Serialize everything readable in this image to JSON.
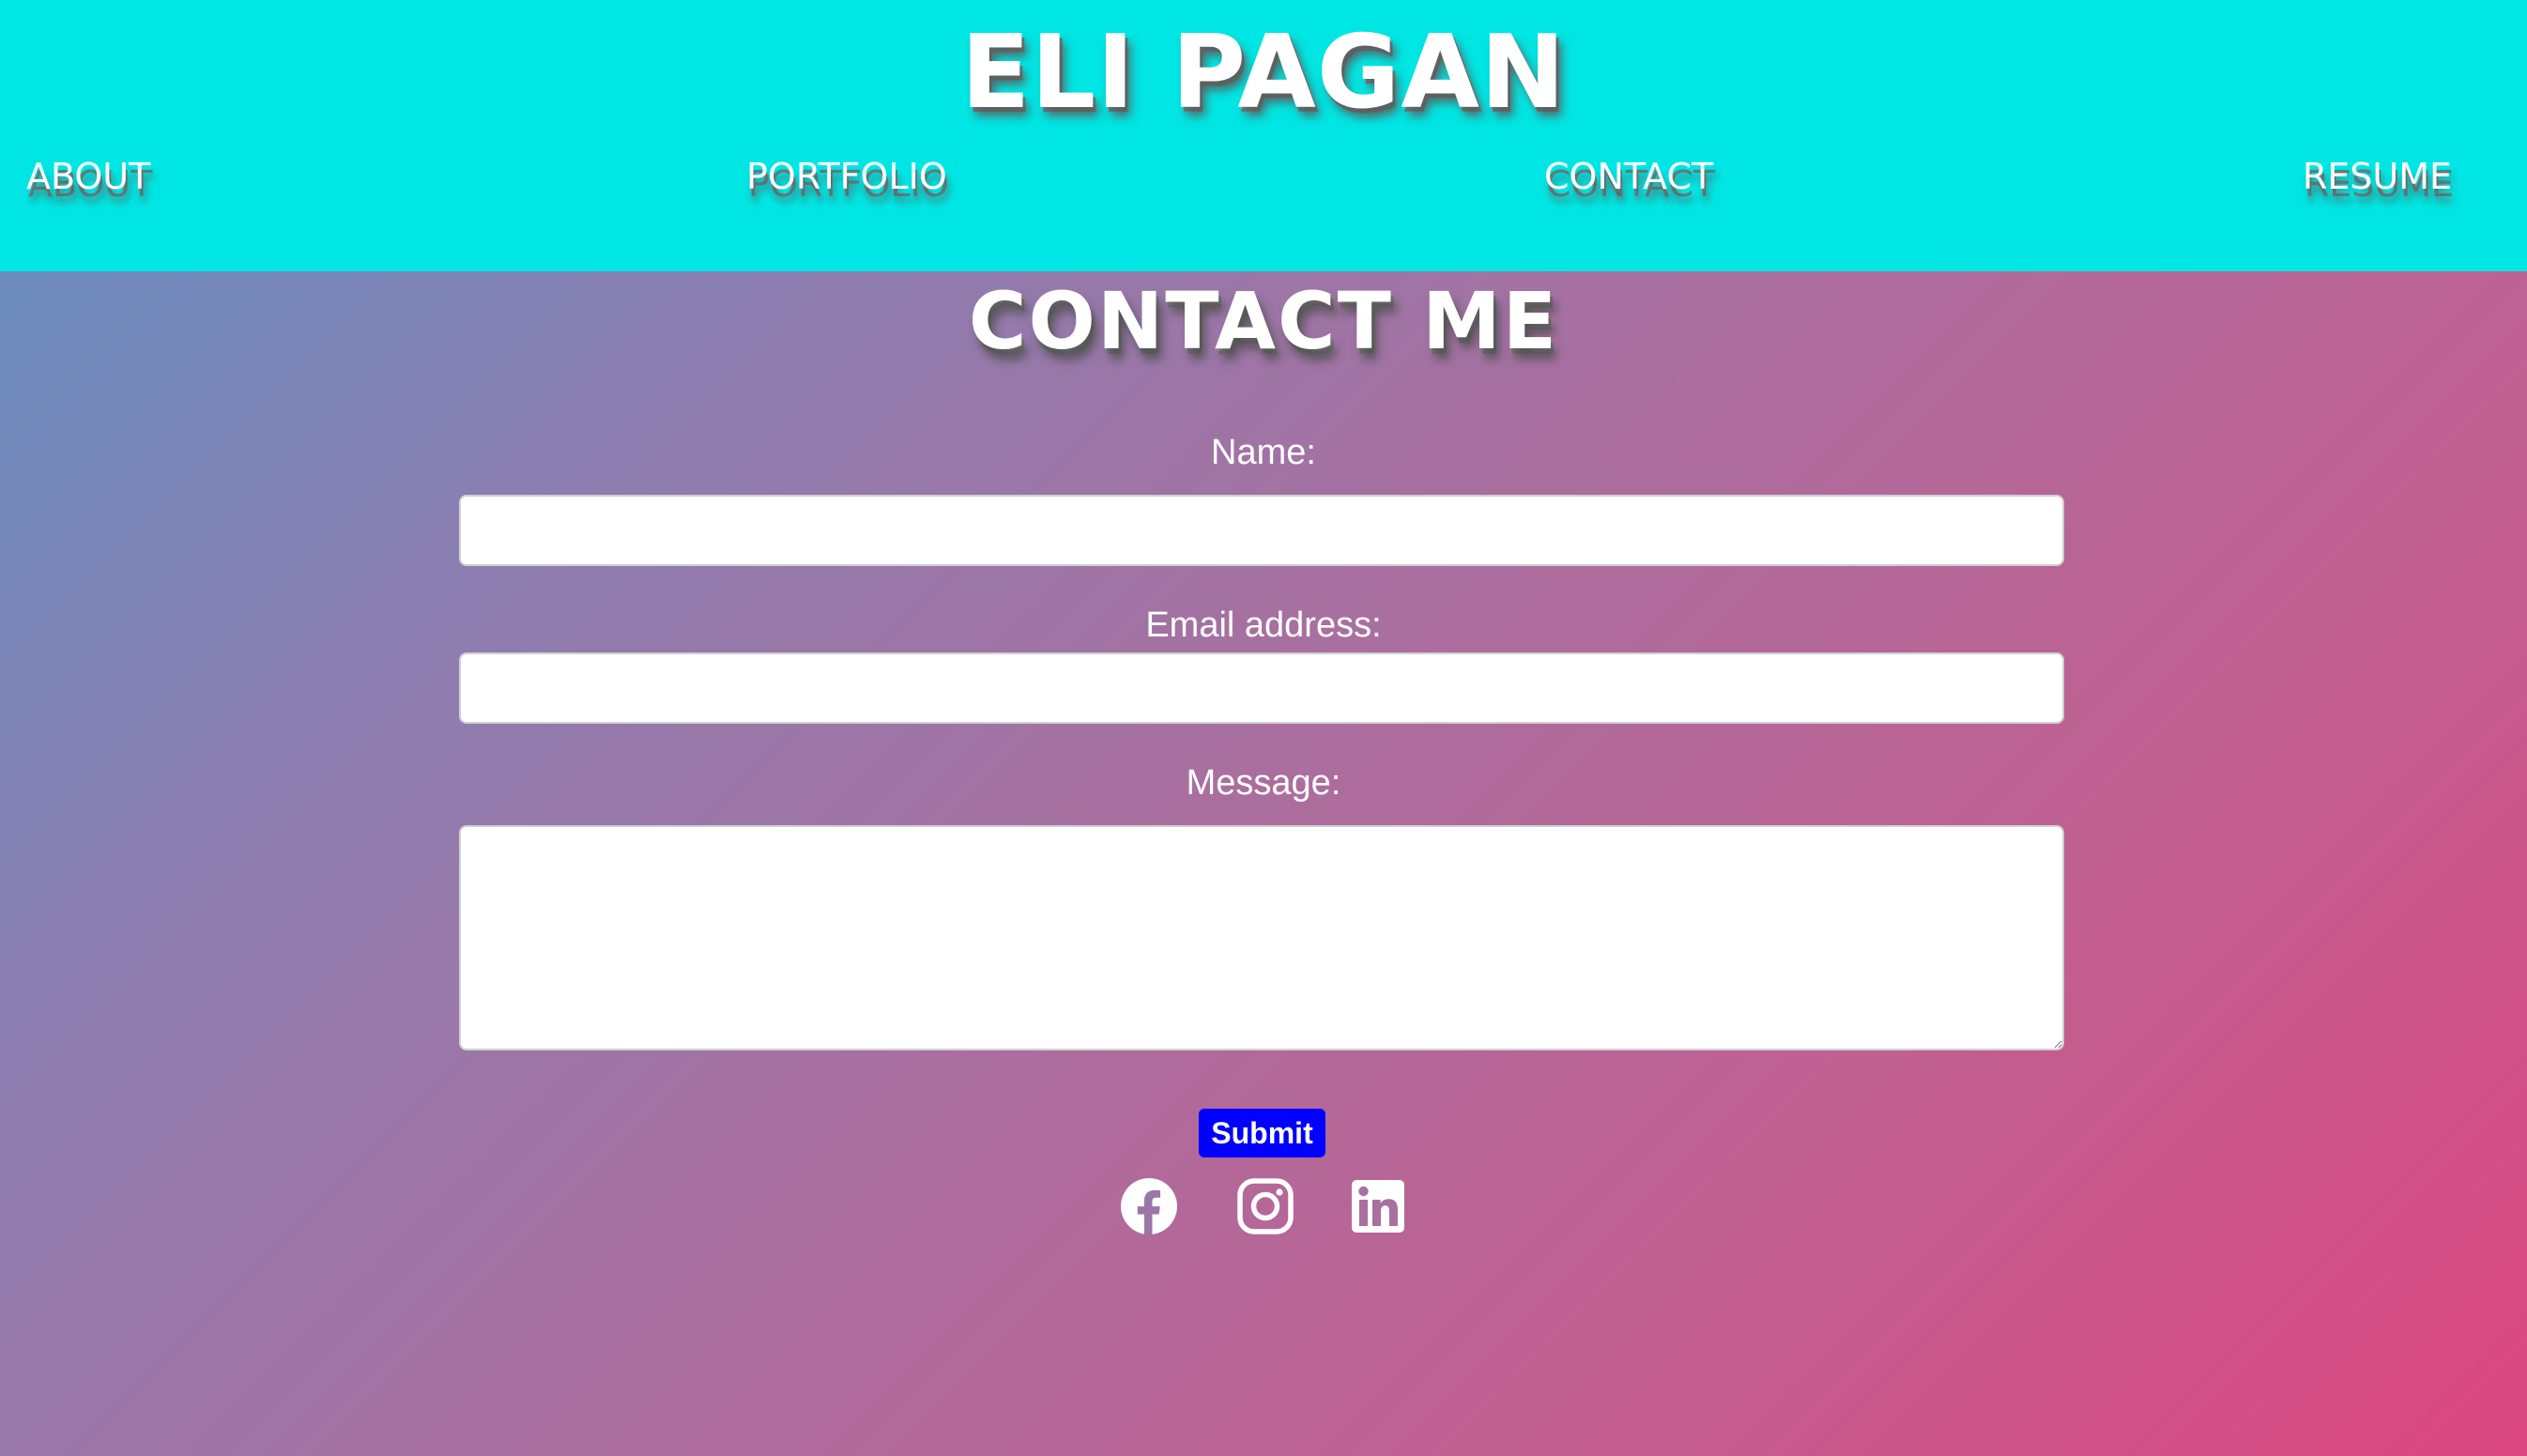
{
  "header": {
    "site_title": "ELI PAGAN",
    "background_color": "#00e6e4",
    "nav": [
      {
        "label": "ABOUT"
      },
      {
        "label": "PORTFOLIO"
      },
      {
        "label": "CONTACT"
      },
      {
        "label": "RESUME"
      }
    ]
  },
  "main": {
    "heading": "CONTACT ME",
    "form": {
      "name_label": "Name:",
      "name_value": "",
      "email_label": "Email address:",
      "email_value": "",
      "message_label": "Message:",
      "message_value": "",
      "submit_label": "Submit",
      "submit_color": "#0000ff"
    },
    "social_icons": [
      "facebook-icon",
      "instagram-icon",
      "linkedin-icon"
    ]
  }
}
